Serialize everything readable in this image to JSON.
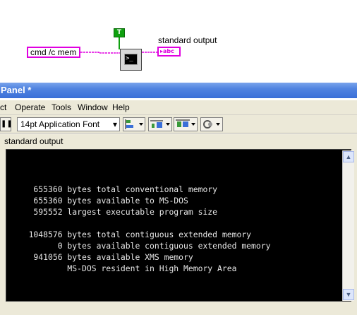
{
  "diagram": {
    "command_constant": "cmd /c mem",
    "boolean_constant": "T",
    "exec_icon_text": ">_",
    "indicator_label": "standard output",
    "indicator_tag": "▸abc"
  },
  "window": {
    "title": "Panel *"
  },
  "menu": {
    "items": [
      "ct",
      "Operate",
      "Tools",
      "Window",
      "Help"
    ]
  },
  "toolbar": {
    "pause_icon": "❚❚",
    "font_select": "14pt Application Font",
    "dropdown_arrow": "▾"
  },
  "panel": {
    "output_label": "standard output",
    "output_lines": [
      "",
      "    655360 bytes total conventional memory",
      "    655360 bytes available to MS-DOS",
      "    595552 largest executable program size",
      "",
      "   1048576 bytes total contiguous extended memory",
      "         0 bytes available contiguous extended memory",
      "    941056 bytes available XMS memory",
      "           MS-DOS resident in High Memory Area"
    ],
    "scroll_up": "▲",
    "scroll_down": "▼"
  },
  "colors": {
    "string_wire": "#e000e0",
    "boolean": "#0fa00f",
    "titlebar": "#5083e0",
    "terminal_bg": "#000000"
  }
}
